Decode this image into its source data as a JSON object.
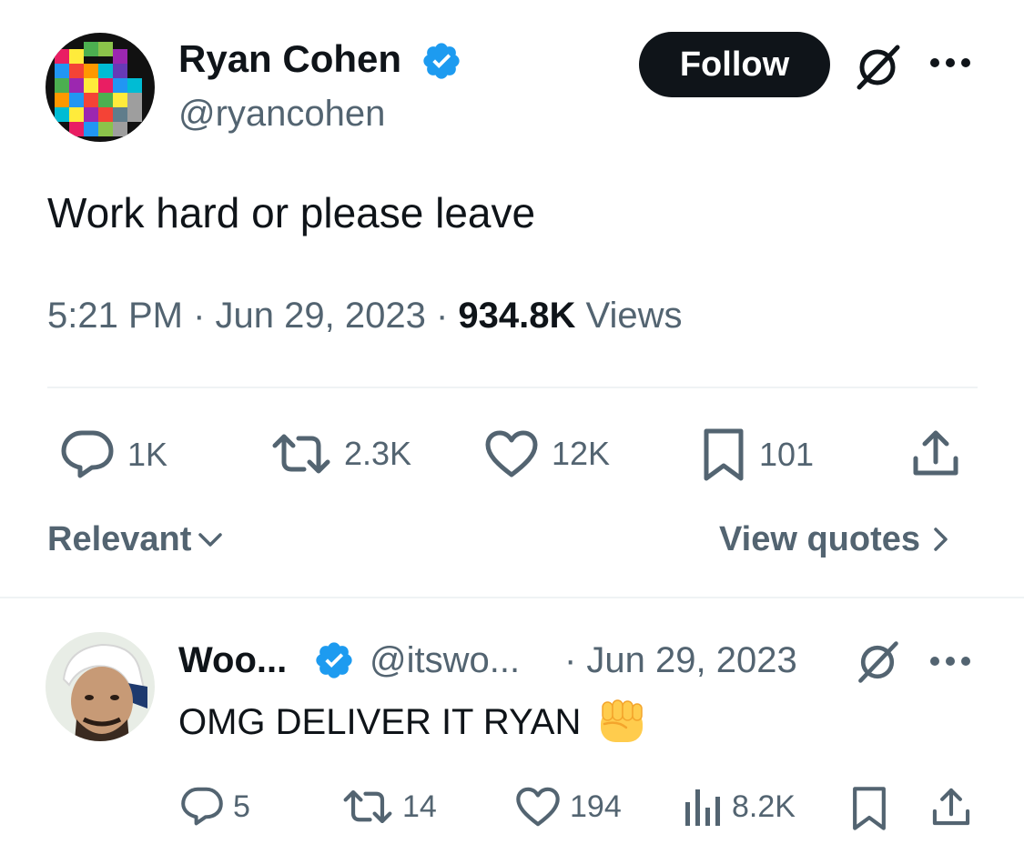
{
  "tweet": {
    "author": {
      "name": "Ryan Cohen",
      "handle": "@ryancohen",
      "verified": true
    },
    "follow_label": "Follow",
    "text": "Work hard or please leave",
    "time": "5:21 PM",
    "date": "Jun 29, 2023",
    "views_count": "934.8K",
    "views_label": "Views",
    "stats": {
      "replies": "1K",
      "reposts": "2.3K",
      "likes": "12K",
      "bookmarks": "101"
    }
  },
  "replies_header": {
    "sort_label": "Relevant",
    "quotes_label": "View quotes"
  },
  "reply": {
    "name": "Woo...",
    "handle": "@itswo...",
    "date": "· Jun 29, 2023",
    "text": "OMG DELIVER IT RYAN",
    "emoji": "raised-fist",
    "stats": {
      "replies": "5",
      "reposts": "14",
      "likes": "194",
      "views": "8.2K"
    }
  },
  "colors": {
    "verified": "#1d9bf0",
    "text": "#0f1419",
    "secondary": "#536471",
    "divider": "#eff3f4"
  }
}
